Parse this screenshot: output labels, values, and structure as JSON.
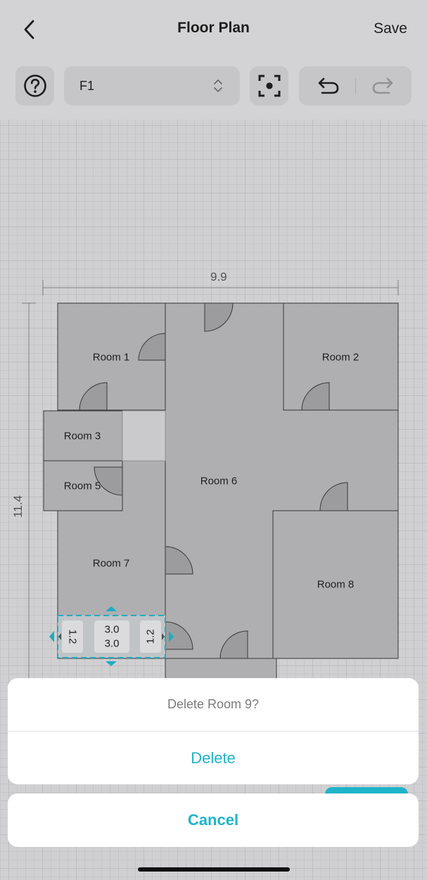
{
  "header": {
    "title": "Floor Plan",
    "save_label": "Save",
    "floor_value": "F1"
  },
  "plan": {
    "width_dim": "9.9",
    "height_dim": "11.4",
    "rooms": [
      {
        "label": "Room 1"
      },
      {
        "label": "Room 2"
      },
      {
        "label": "Room 3"
      },
      {
        "label": "Room 5"
      },
      {
        "label": "Room 6"
      },
      {
        "label": "Room 7"
      },
      {
        "label": "Room 8"
      }
    ],
    "selected_room": {
      "left_dim": "1.2",
      "right_dim": "1.2",
      "top_dim": "3.0",
      "bottom_dim": "3.0"
    }
  },
  "sheet": {
    "message": "Delete Room 9?",
    "delete_label": "Delete",
    "cancel_label": "Cancel"
  },
  "colors": {
    "accent": "#1fb3c9",
    "room_fill": "#b5b5b7",
    "wall": "#3a3a3a"
  }
}
